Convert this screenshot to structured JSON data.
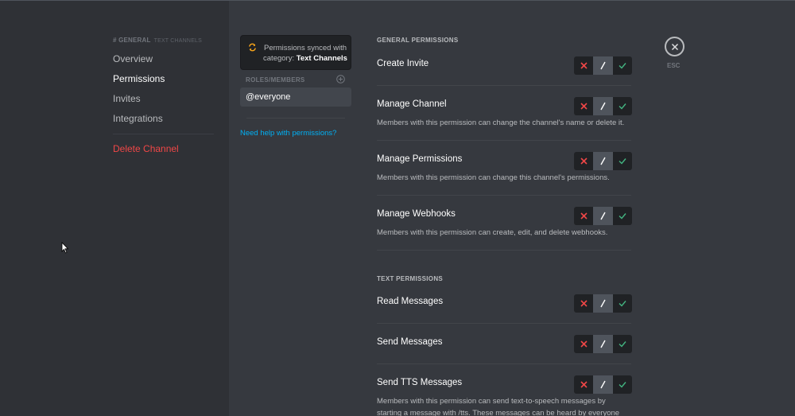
{
  "sidebar": {
    "channel_header": "# GENERAL",
    "channel_sub": "TEXT CHANNELS",
    "items": [
      {
        "label": "Overview"
      },
      {
        "label": "Permissions"
      },
      {
        "label": "Invites"
      },
      {
        "label": "Integrations"
      }
    ],
    "delete_label": "Delete Channel"
  },
  "roles_panel": {
    "sync_text_prefix": "Permissions synced with category: ",
    "sync_category": "Text Channels",
    "roles_label": "ROLES/MEMBERS",
    "selected_role": "@everyone",
    "help_link": "Need help with permissions?"
  },
  "permissions": {
    "general_title": "GENERAL PERMISSIONS",
    "general": [
      {
        "name": "Create Invite",
        "description": "",
        "state": "neutral"
      },
      {
        "name": "Manage Channel",
        "description": "Members with this permission can change the channel's name or delete it.",
        "state": "neutral"
      },
      {
        "name": "Manage Permissions",
        "description": "Members with this permission can change this channel's permissions.",
        "state": "neutral"
      },
      {
        "name": "Manage Webhooks",
        "description": "Members with this permission can create, edit, and delete webhooks.",
        "state": "neutral"
      }
    ],
    "text_title": "TEXT PERMISSIONS",
    "text": [
      {
        "name": "Read Messages",
        "description": "",
        "state": "neutral"
      },
      {
        "name": "Send Messages",
        "description": "",
        "state": "neutral"
      },
      {
        "name": "Send TTS Messages",
        "description": "Members with this permission can send text-to-speech messages by starting a message with /tts. These messages can be heard by everyone",
        "state": "neutral"
      }
    ]
  },
  "close": {
    "label": "ESC"
  },
  "colors": {
    "deny": "#f04747",
    "allow": "#43b581",
    "link": "#00b0f4",
    "danger": "#f04747"
  }
}
